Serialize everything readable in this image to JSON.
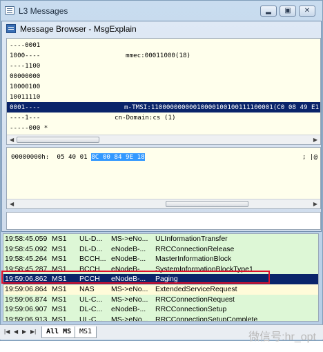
{
  "outer_window": {
    "title": "L3 Messages",
    "min_label": "▂",
    "restore_label": "▣",
    "close_label": "✕"
  },
  "dialog": {
    "title": "Message Browser - MsgExplain"
  },
  "decode_lines": [
    {
      "bits": "----0001",
      "desc": ""
    },
    {
      "bits": "1000----",
      "desc": "mmec:00011000(18)"
    },
    {
      "bits": "----1100",
      "desc": ""
    },
    {
      "bits": "00000000",
      "desc": ""
    },
    {
      "bits": "10000100",
      "desc": ""
    },
    {
      "bits": "10011110",
      "desc": ""
    },
    {
      "bits": "0001----",
      "desc": "m-TMSI:11000000000010000100100111100001(C0 08 49 E1"
    },
    {
      "bits": "----1---",
      "desc": "cn-Domain:cs (1)"
    },
    {
      "bits": "-----000 *",
      "desc": ""
    }
  ],
  "hex": {
    "offset": "00000000h:",
    "plain": "05 40 01",
    "highlighted": "8C 00 84 9E 18",
    "tail": "; |@"
  },
  "messages": [
    {
      "time": "19:58:45.059",
      "ms": "MS1",
      "ch": "UL-D...",
      "dir": "MS->eNo...",
      "msg": "ULInformationTransfer"
    },
    {
      "time": "19:58:45.092",
      "ms": "MS1",
      "ch": "DL-D...",
      "dir": "eNodeB-...",
      "msg": "RRCConnectionRelease"
    },
    {
      "time": "19:58:45.264",
      "ms": "MS1",
      "ch": "BCCH...",
      "dir": "eNodeB-...",
      "msg": "MasterInformationBlock"
    },
    {
      "time": "19:58:45.287",
      "ms": "MS1",
      "ch": "BCCH...",
      "dir": "eNodeB-...",
      "msg": "SystemInformationBlockType1"
    },
    {
      "time": "19:59:06.862",
      "ms": "MS1",
      "ch": "PCCH",
      "dir": "eNodeB-...",
      "msg": "Paging"
    },
    {
      "time": "19:59:06.864",
      "ms": "MS1",
      "ch": "NAS",
      "dir": "MS->eNo...",
      "msg": "ExtendedServiceRequest"
    },
    {
      "time": "19:59:06.874",
      "ms": "MS1",
      "ch": "UL-C...",
      "dir": "MS->eNo...",
      "msg": "RRCConnectionRequest"
    },
    {
      "time": "19:59:06.907",
      "ms": "MS1",
      "ch": "DL-C...",
      "dir": "eNodeB-...",
      "msg": "RRCConnectionSetup"
    },
    {
      "time": "19:59:06.913",
      "ms": "MS1",
      "ch": "UL-C...",
      "dir": "MS->eNo...",
      "msg": "RRCConnectionSetupComplete"
    }
  ],
  "tabs": [
    "All MS",
    "MS1"
  ],
  "watermark": "微信号:hr_opt"
}
